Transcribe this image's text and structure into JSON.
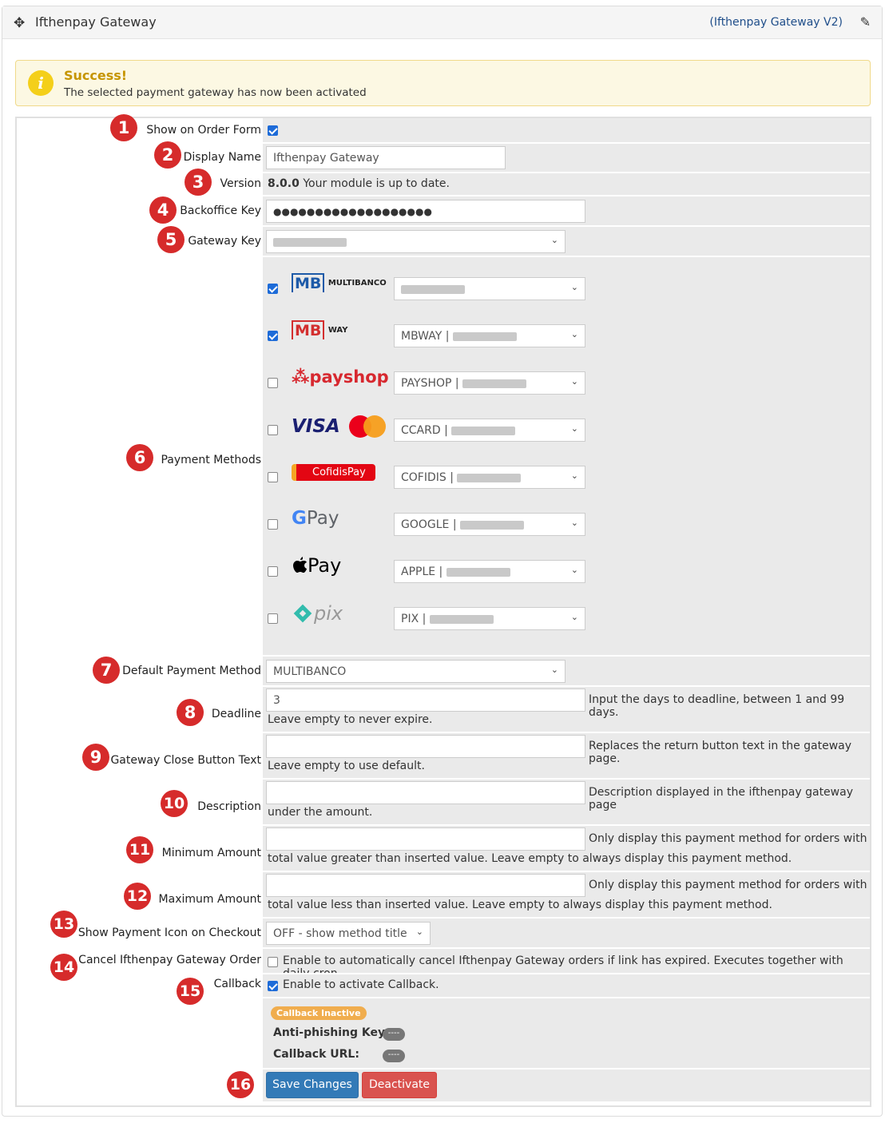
{
  "header": {
    "title": "Ifthenpay Gateway",
    "version_link": "(Ifthenpay Gateway V2)",
    "move_icon": "move-icon",
    "edit_icon": "edit-icon"
  },
  "alert": {
    "heading": "Success!",
    "message": "The selected payment gateway has now been activated",
    "icon": "info-icon"
  },
  "markers": [
    "1",
    "2",
    "3",
    "4",
    "5",
    "6",
    "7",
    "8",
    "9",
    "10",
    "11",
    "12",
    "13",
    "14",
    "15",
    "16"
  ],
  "form": {
    "show_on_order_form": {
      "label": "Show on Order Form",
      "checked": true
    },
    "display_name": {
      "label": "Display Name",
      "value": "Ifthenpay Gateway"
    },
    "version": {
      "label": "Version",
      "number": "8.0.0",
      "status": "Your module is up to date."
    },
    "backoffice_key": {
      "label": "Backoffice Key",
      "value": "●●●●●●●●●●●●●●●●●●●"
    },
    "gateway_key": {
      "label": "Gateway Key"
    },
    "payment_methods": {
      "label": "Payment Methods",
      "items": [
        {
          "name": "multibanco",
          "checked": true,
          "prefix": ""
        },
        {
          "name": "mbway",
          "checked": true,
          "prefix": "MBWAY | "
        },
        {
          "name": "payshop",
          "checked": false,
          "prefix": "PAYSHOP | "
        },
        {
          "name": "ccard",
          "checked": false,
          "prefix": "CCARD | "
        },
        {
          "name": "cofidis",
          "checked": false,
          "prefix": "COFIDIS | "
        },
        {
          "name": "google",
          "checked": false,
          "prefix": "GOOGLE | "
        },
        {
          "name": "apple",
          "checked": false,
          "prefix": "APPLE | "
        },
        {
          "name": "pix",
          "checked": false,
          "prefix": "PIX | "
        }
      ],
      "logo_text": {
        "mb": "MB",
        "multibanco": "MULTIBANCO",
        "way": "WAY",
        "payshop": "payshop",
        "visa": "VISA",
        "cofidis": "CofidisPay",
        "gpay": "Pay",
        "g": "G",
        "apay": "Pay",
        "pix": "pix"
      }
    },
    "default_payment_method": {
      "label": "Default Payment Method",
      "value": "MULTIBANCO"
    },
    "deadline": {
      "label": "Deadline",
      "value": "3",
      "help1": "Input the days to deadline, between 1 and 99 days.",
      "help2": "Leave empty to never expire."
    },
    "close_button_text": {
      "label": "Gateway Close Button Text",
      "help1": "Replaces the return button text in the gateway page.",
      "help2": "Leave empty to use default."
    },
    "description": {
      "label": "Description",
      "help1": "Description displayed in the ifthenpay gateway page",
      "help2": "under the amount."
    },
    "minimum_amount": {
      "label": "Minimum Amount",
      "help1": "Only display this payment method for orders with",
      "help2": "total value greater than inserted value. Leave empty to always display this payment method."
    },
    "maximum_amount": {
      "label": "Maximum Amount",
      "help1": "Only display this payment method for orders with",
      "help2": "total value less than inserted value. Leave empty to always display this payment method."
    },
    "show_payment_icon": {
      "label": "Show Payment Icon on Checkout",
      "value": "OFF - show method title"
    },
    "cancel_order": {
      "label": "Cancel Ifthenpay Gateway Order",
      "checked": false,
      "text": "Enable to automatically cancel Ifthenpay Gateway orders if link has expired. Executes together with daily cron."
    },
    "callback": {
      "label": "Callback",
      "checked": true,
      "text": "Enable to activate Callback.",
      "status_badge": "Callback Inactive",
      "anti_phishing_label": "Anti-phishing Key:",
      "anti_phishing_value": "----",
      "callback_url_label": "Callback URL:",
      "callback_url_value": "----"
    },
    "buttons": {
      "save": "Save Changes",
      "deactivate": "Deactivate"
    }
  },
  "colors": {
    "marker": "#d62b2b",
    "primary": "#337ab7",
    "danger": "#d9534f",
    "warning": "#f0ad4e",
    "checkbox": "#1d6bd8"
  }
}
